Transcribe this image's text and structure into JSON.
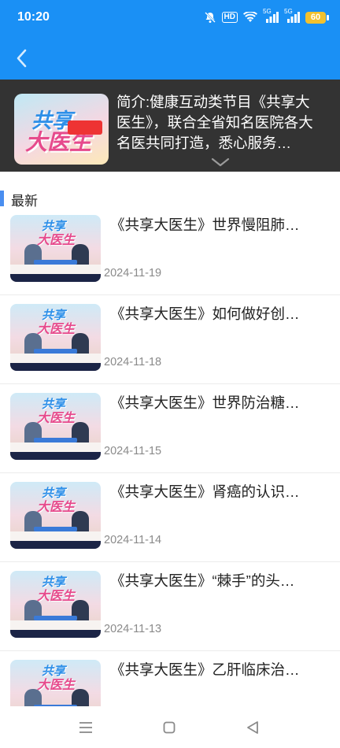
{
  "status_bar": {
    "time": "10:20",
    "hd_label": "HD",
    "net1": "5G",
    "net2": "5G",
    "battery": "60",
    "icons": [
      "mute-icon",
      "wifi-icon",
      "signal-icon",
      "signal-icon"
    ]
  },
  "header": {
    "back_icon": "chevron-left-icon",
    "color": "#1a90f5"
  },
  "intro": {
    "cover_title_1": "共享",
    "cover_title_2": "大医生",
    "text": "简介:健康互动类节目《共享大医生》，联合全省知名医院各大名医共同打造，悉心服务…",
    "expand_icon": "chevron-down-icon",
    "background": "#333333"
  },
  "section": {
    "title": "最新",
    "accent": "#4a8ef0"
  },
  "items": [
    {
      "title": "《共享大医生》世界慢阻肺…",
      "date": "2024-11-19"
    },
    {
      "title": "《共享大医生》如何做好创…",
      "date": "2024-11-18"
    },
    {
      "title": "《共享大医生》世界防治糖…",
      "date": "2024-11-15"
    },
    {
      "title": "《共享大医生》肾癌的认识…",
      "date": "2024-11-14"
    },
    {
      "title": "《共享大医生》“棘手”的头…",
      "date": "2024-11-13"
    },
    {
      "title": "《共享大医生》乙肝临床治…",
      "date": ""
    }
  ],
  "thumb_logo": {
    "line1": "共享",
    "line2": "大医生"
  },
  "nav": [
    "menu-icon",
    "home-square-icon",
    "back-triangle-icon"
  ]
}
